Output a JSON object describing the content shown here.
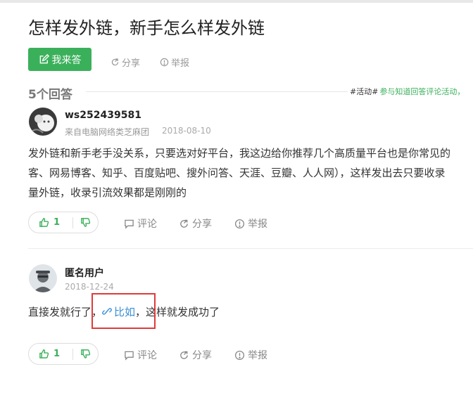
{
  "question": {
    "title": "怎样发外链，新手怎么样发外链",
    "answer_button_label": "我来答",
    "share_label": "分享",
    "report_label": "举报"
  },
  "answers_header": {
    "count_label": "5个回答",
    "activity_tag": "#活动#",
    "activity_text": "参与知道回答评论活动，"
  },
  "answers": [
    {
      "username": "ws252439581",
      "source": "来自电脑网络类芝麻团",
      "date": "2018-08-10",
      "text_lines": [
        "发外链和新手老手没关系，只要选对好平台，我这边给你推荐几个高质量平台也是你常见的",
        "客、网易博客、知乎、百度贴吧、搜外问答、天涯、豆瓣、人人网），这样发出去只要收录",
        "量外链，收录引流效果都是刚刚的"
      ],
      "upvotes": "1",
      "comment_label": "评论",
      "share_label": "分享",
      "report_label": "举报"
    },
    {
      "username": "匿名用户",
      "date": "2018-12-24",
      "text_before": "直接发就行了，",
      "link_text": "比如",
      "text_after": "，这样就发成功了",
      "upvotes": "1",
      "comment_label": "评论",
      "share_label": "分享",
      "report_label": "举报"
    }
  ],
  "colors": {
    "accent_green": "#3bb05b",
    "link_blue": "#3a8fd6",
    "highlight_red": "#e03a3a"
  }
}
